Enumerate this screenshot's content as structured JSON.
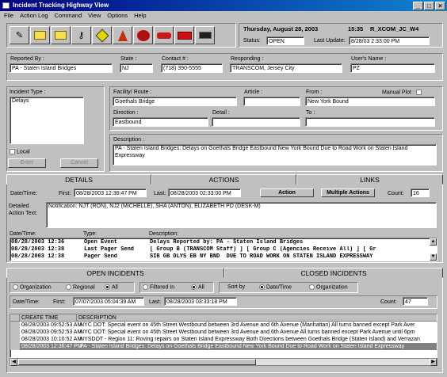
{
  "window": {
    "title": "Incident Tracking Highway View"
  },
  "menu": [
    "File",
    "Action Log",
    "Command",
    "View",
    "Options",
    "Help"
  ],
  "header": {
    "date": "Thursday, August 28, 2003",
    "time": "15:35",
    "user_code": "R_XCOM_JC_W4",
    "status_label": "Status:",
    "status_value": "OPEN",
    "last_update_label": "Last Update:",
    "last_update_value": "8/28/03 2:33:00 PM"
  },
  "toolbar_icons": [
    "edit-icon",
    "folder-open-icon",
    "folder-icon",
    "key-icon",
    "diamond-sign-icon",
    "cone-icon",
    "tree-icon",
    "car-icon",
    "fire-truck-icon",
    "radio-icon"
  ],
  "reporter": {
    "reported_by_label": "Reported By :",
    "reported_by": "PA - Staten Island Bridges",
    "state_label": "State :",
    "state": "NJ",
    "contact_label": "Contact # :",
    "contact": "(718) 390-5555",
    "responding_label": "Responding :",
    "responding": "TRANSCOM, Jersey City",
    "users_name_label": "User's Name :",
    "users_name": "PZ"
  },
  "incident": {
    "type_label": "Incident Type :",
    "type": "Delays",
    "local_label": "Local",
    "enter_label": "Enter",
    "cancel_label": "Cancel",
    "facility_label": "Facility/ Route :",
    "facility": "Goethals Bridge",
    "article_label": "Article :",
    "article": "",
    "from_label": "From :",
    "from": "New York Bound",
    "manual_plot_label": "Manual Plot :",
    "direction_label": "Direction :",
    "direction": "Eastbound",
    "detail_label": "Detail :",
    "detail": "",
    "to_label": "To :",
    "to": "",
    "description_label": "Description :",
    "description": "PA - Staten Island Bridges: Delays on Goethals Bridge Eastbound New York Bound  Due to Road Work on Staten Island Expressway"
  },
  "tabs1": [
    "DETAILS",
    "ACTIONS",
    "LINKS"
  ],
  "actions": {
    "datetime_label": "Date/Time:",
    "first_label": "First:",
    "first": "08/28/2003 12:36:47 PM",
    "last_label": "Last:",
    "last": "08/28/2003 02:33:00 PM",
    "action_btn": "Action",
    "multiple_btn": "Multiple Actions",
    "count_label": "Count:",
    "count": "16",
    "detailed_label": "Detailed Action Text:",
    "detailed_text": "Notification: NJT (RON), NJ2 (MICHELLE), SHA (ANTON), ELIZABETH PD (DESK-M)",
    "cols": [
      "Date/Time:",
      "Type:",
      "Description:"
    ],
    "rows": [
      [
        "08/28/2003 12:36",
        "Open Event",
        "Delays Reported by: PA - Staten Island Bridges"
      ],
      [
        "08/28/2003 12:38",
        "Last Pager Send",
        "[ Group B (TRANSCOM Staff) ] [ Group C (Agencies Receive All) ] [ Gr"
      ],
      [
        "08/28/2003 12:38",
        "Pager Send",
        "SIB GB DLYS EB NY BND  DUE TO ROAD WORK ON STATEN ISLAND EXPRESSWAY"
      ]
    ]
  },
  "tabs2": [
    "OPEN INCIDENTS",
    "CLOSED INCIDENTS"
  ],
  "filters": {
    "organization": "Organization",
    "regional": "Regional",
    "all": "All",
    "filtered_in": "Filtered In",
    "all2": "All",
    "sort_by": "Sort by",
    "datetime": "Date/Time",
    "organization2": "Organization"
  },
  "incidents": {
    "datetime_label": "Date/Time:",
    "first_label": "First:",
    "first": "07/07/2003 05:04:39 AM",
    "last_label": "Last:",
    "last": "08/28/2003 03:33:18 PM",
    "count_label": "Count:",
    "count": "47",
    "cols": [
      "CREATE TIME",
      "DESCRIPTION"
    ],
    "rows": [
      [
        "08/28/2003 09:52:53 AM",
        "NYC DOT: Special event on 45th Street Westbound between 3rd Avenue and 6th Avenue (Manhattan)  All turns banned except Park Aver"
      ],
      [
        "08/28/2003 09:52:53 AM",
        "NYC DOT: Special event on 45th Street Westbound between 3rd Avenue and 6th Avenue  All turns banned except Park Avenue until 6pm"
      ],
      [
        "08/28/2003 10:10:52 AM",
        "NYSDOT - Region 11: Roving repairs on Staten Island Expressway Both Directions between Goethals Bridge (Staten Island) and Verrazan"
      ],
      [
        "08/28/2003 12:36:47 PM",
        "PA - Staten Island Bridges: Delays on Goethals Bridge Eastbound New York Bound  Due to Road Work on Staten Island Expressway"
      ]
    ]
  }
}
